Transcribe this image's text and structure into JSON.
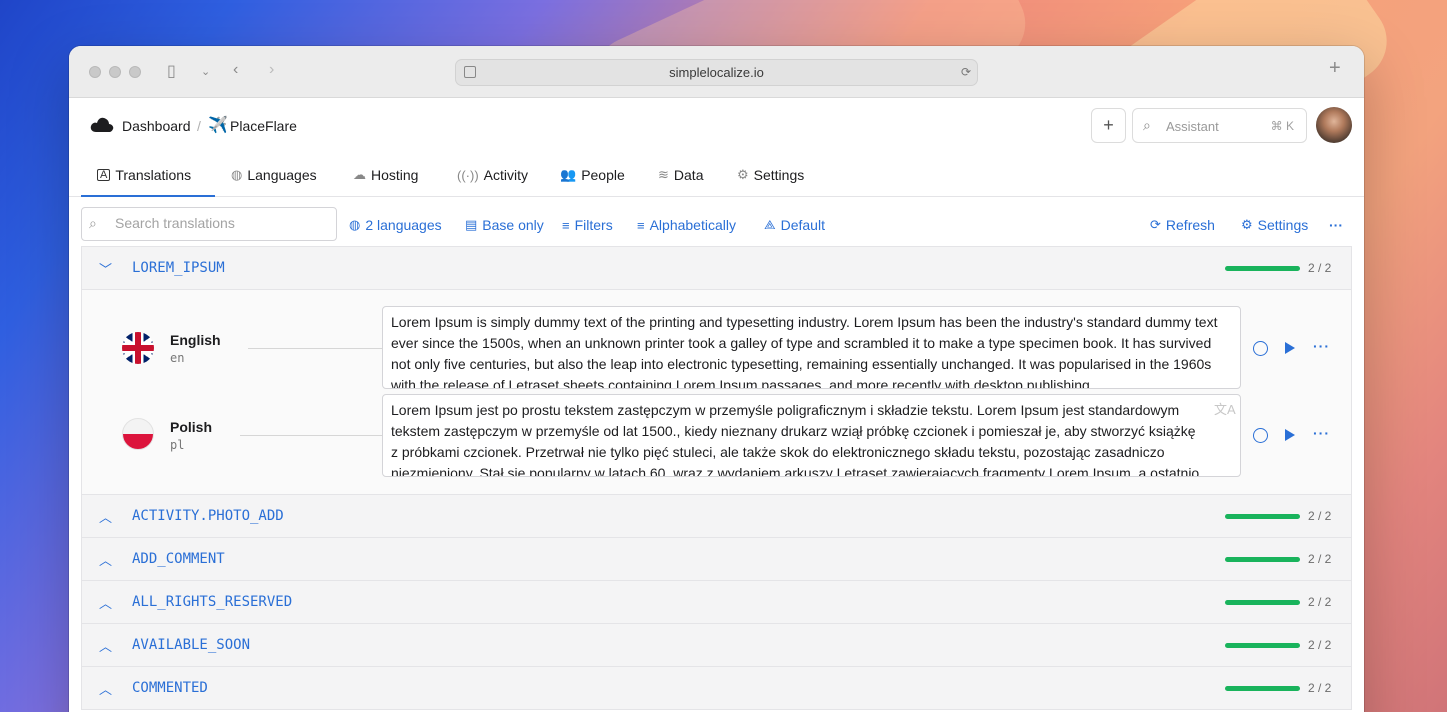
{
  "browser": {
    "url": "simplelocalize.io"
  },
  "header": {
    "breadcrumb_root": "Dashboard",
    "breadcrumb_sep": "/",
    "project_name": "PlaceFlare",
    "add_label": "+",
    "assistant_placeholder": "Assistant",
    "assistant_shortcut": "⌘ K"
  },
  "tabs": [
    {
      "label": "Translations",
      "icon": "translations-icon",
      "active": true
    },
    {
      "label": "Languages",
      "icon": "globe-icon"
    },
    {
      "label": "Hosting",
      "icon": "cloud-icon"
    },
    {
      "label": "Activity",
      "icon": "activity-icon"
    },
    {
      "label": "People",
      "icon": "people-icon"
    },
    {
      "label": "Data",
      "icon": "database-icon"
    },
    {
      "label": "Settings",
      "icon": "gear-icon"
    }
  ],
  "toolbar": {
    "search_placeholder": "Search translations",
    "languages": "2 languages",
    "base_only": "Base only",
    "filters": "Filters",
    "sort": "Alphabetically",
    "view": "Default",
    "refresh": "Refresh",
    "settings": "Settings",
    "more": "···"
  },
  "keys": [
    {
      "name": "LOREM_IPSUM",
      "expanded": true,
      "progress": "2 / 2",
      "progress_fraction": 1.0,
      "translations": [
        {
          "language": "English",
          "code": "en",
          "text": "Lorem Ipsum is simply dummy text of the printing and typesetting industry. Lorem Ipsum has been the industry's standard dummy text ever since the 1500s, when an unknown printer took a galley of type and scrambled it to make a type specimen book. It has survived not only five centuries, but also the leap into electronic typesetting, remaining essentially unchanged. It was popularised in the 1960s with the release of Letraset sheets containing Lorem Ipsum passages, and more recently with desktop publishing"
        },
        {
          "language": "Polish",
          "code": "pl",
          "text": "Lorem Ipsum jest po prostu tekstem zastępczym w przemyśle poligraficznym i składzie tekstu. Lorem Ipsum jest standardowym tekstem zastępczym w przemyśle od lat 1500., kiedy nieznany drukarz wziął próbkę czcionek i pomieszał je, aby stworzyć książkę z próbkami czcionek. Przetrwał nie tylko pięć stuleci, ale także skok do elektronicznego składu tekstu, pozostając zasadniczo niezmieniony. Stał się popularny w latach 60. wraz z wydaniem arkuszy Letraset zawierających fragmenty Lorem Ipsum, a ostatnio"
        }
      ]
    },
    {
      "name": "ACTIVITY.PHOTO_ADD",
      "expanded": false,
      "progress": "2 / 2",
      "progress_fraction": 1.0
    },
    {
      "name": "ADD_COMMENT",
      "expanded": false,
      "progress": "2 / 2",
      "progress_fraction": 1.0
    },
    {
      "name": "ALL_RIGHTS_RESERVED",
      "expanded": false,
      "progress": "2 / 2",
      "progress_fraction": 1.0
    },
    {
      "name": "AVAILABLE_SOON",
      "expanded": false,
      "progress": "2 / 2",
      "progress_fraction": 1.0
    },
    {
      "name": "COMMENTED",
      "expanded": false,
      "progress": "2 / 2",
      "progress_fraction": 1.0
    }
  ],
  "colors": {
    "accent": "#2a6fd6",
    "progress": "#19b35c"
  }
}
